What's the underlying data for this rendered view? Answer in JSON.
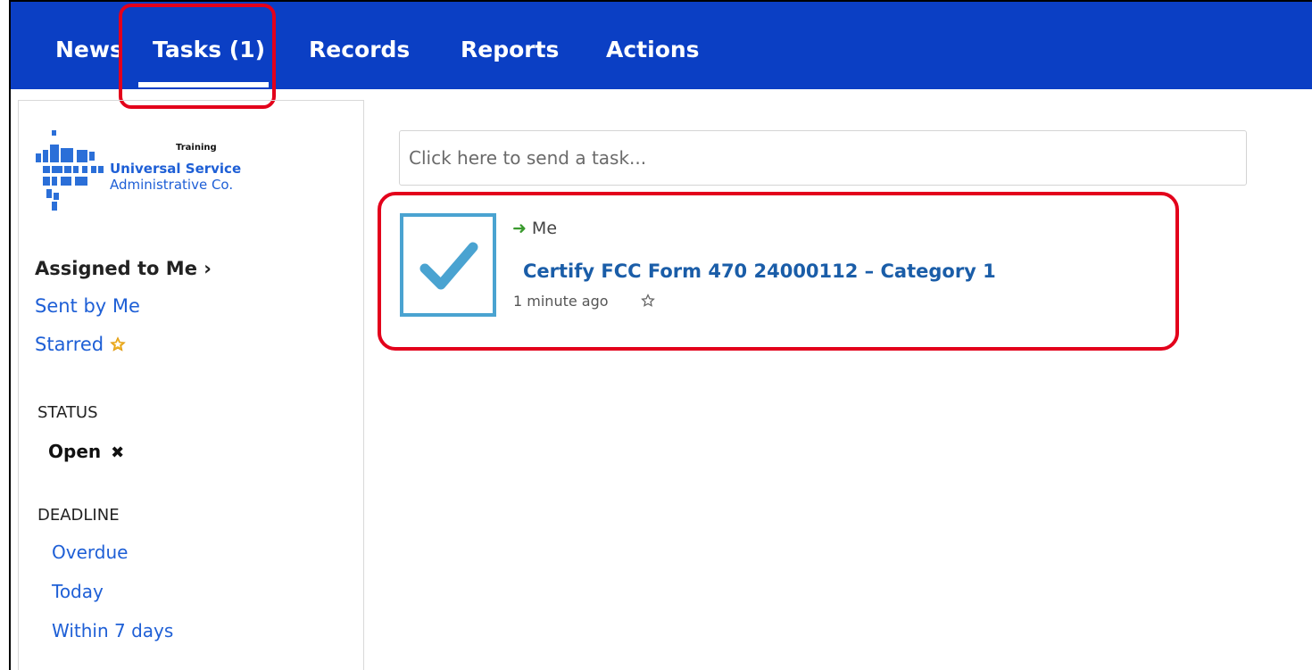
{
  "nav": {
    "tabs": [
      "News",
      "Tasks (1)",
      "Records",
      "Reports",
      "Actions"
    ]
  },
  "logo": {
    "training": "Training",
    "line1": "Universal Service",
    "line2": "Administrative Co."
  },
  "sidebar": {
    "assigned": "Assigned to Me ›",
    "sent": "Sent by Me",
    "starred": "Starred",
    "status_header": "STATUS",
    "status_open": "Open",
    "deadline_header": "DEADLINE",
    "deadline_items": [
      "Overdue",
      "Today",
      "Within 7 days"
    ]
  },
  "main": {
    "input_placeholder": "Click here to send a task...",
    "task": {
      "assignee": "Me",
      "title": "Certify FCC Form 470 24000112 – Category 1",
      "time": "1 minute ago"
    }
  },
  "colors": {
    "nav_bg": "#0b3fc4",
    "link": "#1e5fd6",
    "highlight": "#e3001b",
    "check": "#4aa3d1"
  }
}
